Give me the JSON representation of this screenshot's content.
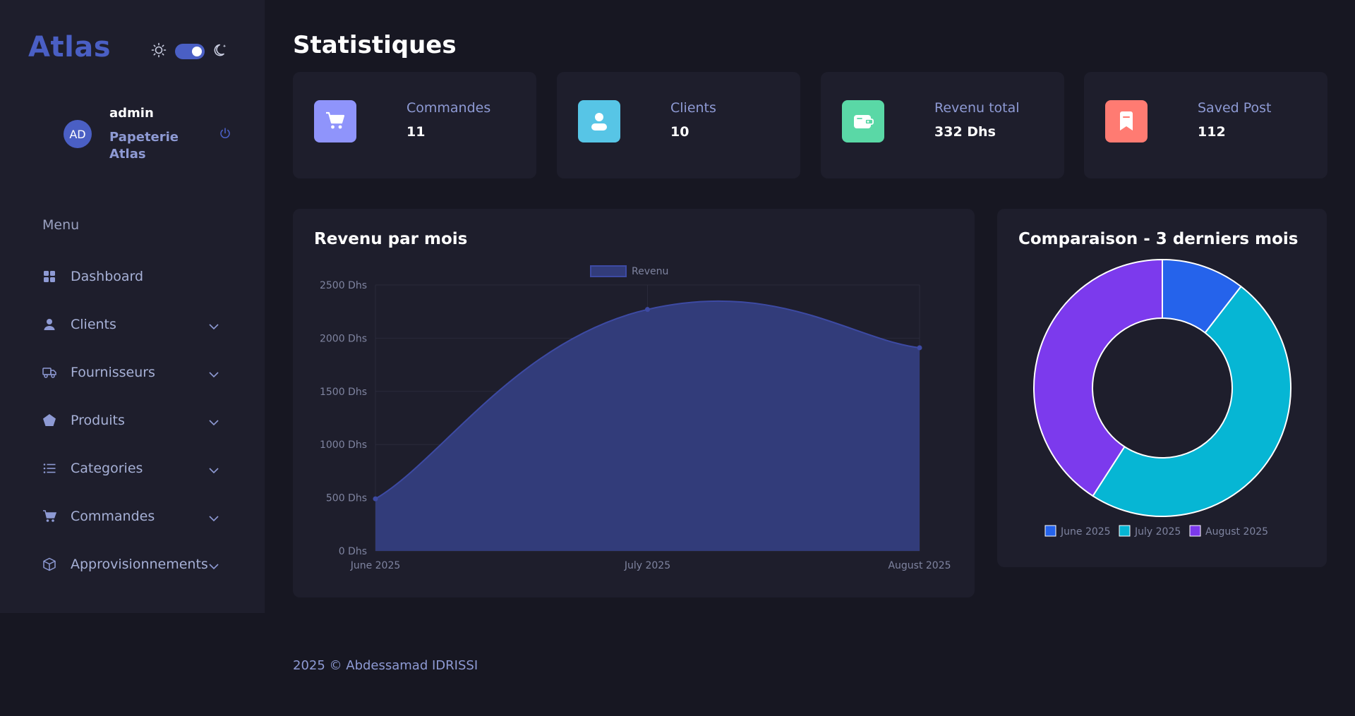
{
  "sidebar": {
    "logo": "Atlas",
    "user": {
      "initials": "AD",
      "name": "admin",
      "company": "Papeterie Atlas"
    },
    "menu_heading": "Menu",
    "items": [
      {
        "label": "Dashboard",
        "icon": "grid-icon",
        "expandable": false
      },
      {
        "label": "Clients",
        "icon": "user-icon",
        "expandable": true
      },
      {
        "label": "Fournisseurs",
        "icon": "truck-icon",
        "expandable": true
      },
      {
        "label": "Produits",
        "icon": "pentagon-icon",
        "expandable": true
      },
      {
        "label": "Categories",
        "icon": "list-icon",
        "expandable": true
      },
      {
        "label": "Commandes",
        "icon": "cart-icon",
        "expandable": true
      },
      {
        "label": "Approvisionnements",
        "icon": "box-icon",
        "expandable": true
      }
    ]
  },
  "header": {
    "title": "Statistiques"
  },
  "stats": [
    {
      "label": "Commandes",
      "value": "11",
      "icon": "cart-icon",
      "color": "#8f94fb"
    },
    {
      "label": "Clients",
      "value": "10",
      "icon": "user-icon",
      "color": "#57c5e6"
    },
    {
      "label": "Revenu total",
      "value": "332 Dhs",
      "icon": "wallet-icon",
      "color": "#5ad8a6"
    },
    {
      "label": "Saved Post",
      "value": "112",
      "icon": "bookmark-icon",
      "color": "#ff7b72"
    }
  ],
  "revenue_panel": {
    "title": "Revenu par mois"
  },
  "comparison_panel": {
    "title": "Comparaison - 3 derniers mois"
  },
  "chart_data": [
    {
      "type": "area",
      "title": "Revenu par mois",
      "categories": [
        "June 2025",
        "July 2025",
        "August 2025"
      ],
      "series": [
        {
          "name": "Revenu",
          "values": [
            490,
            2270,
            1910
          ],
          "color": "#3b4bab"
        }
      ],
      "y_ticks": [
        "0 Dhs",
        "500 Dhs",
        "1000 Dhs",
        "1500 Dhs",
        "2000 Dhs",
        "2500 Dhs"
      ],
      "ylim": [
        0,
        2500
      ],
      "grid": true,
      "legend": "top"
    },
    {
      "type": "pie",
      "title": "Comparaison - 3 derniers mois",
      "categories": [
        "June 2025",
        "July 2025",
        "August 2025"
      ],
      "values": [
        490,
        2270,
        1910
      ],
      "colors": [
        "#2563eb",
        "#06b6d4",
        "#7c3aed"
      ],
      "legend": "bottom"
    }
  ],
  "footer": {
    "text": "2025 © Abdessamad IDRISSI"
  }
}
